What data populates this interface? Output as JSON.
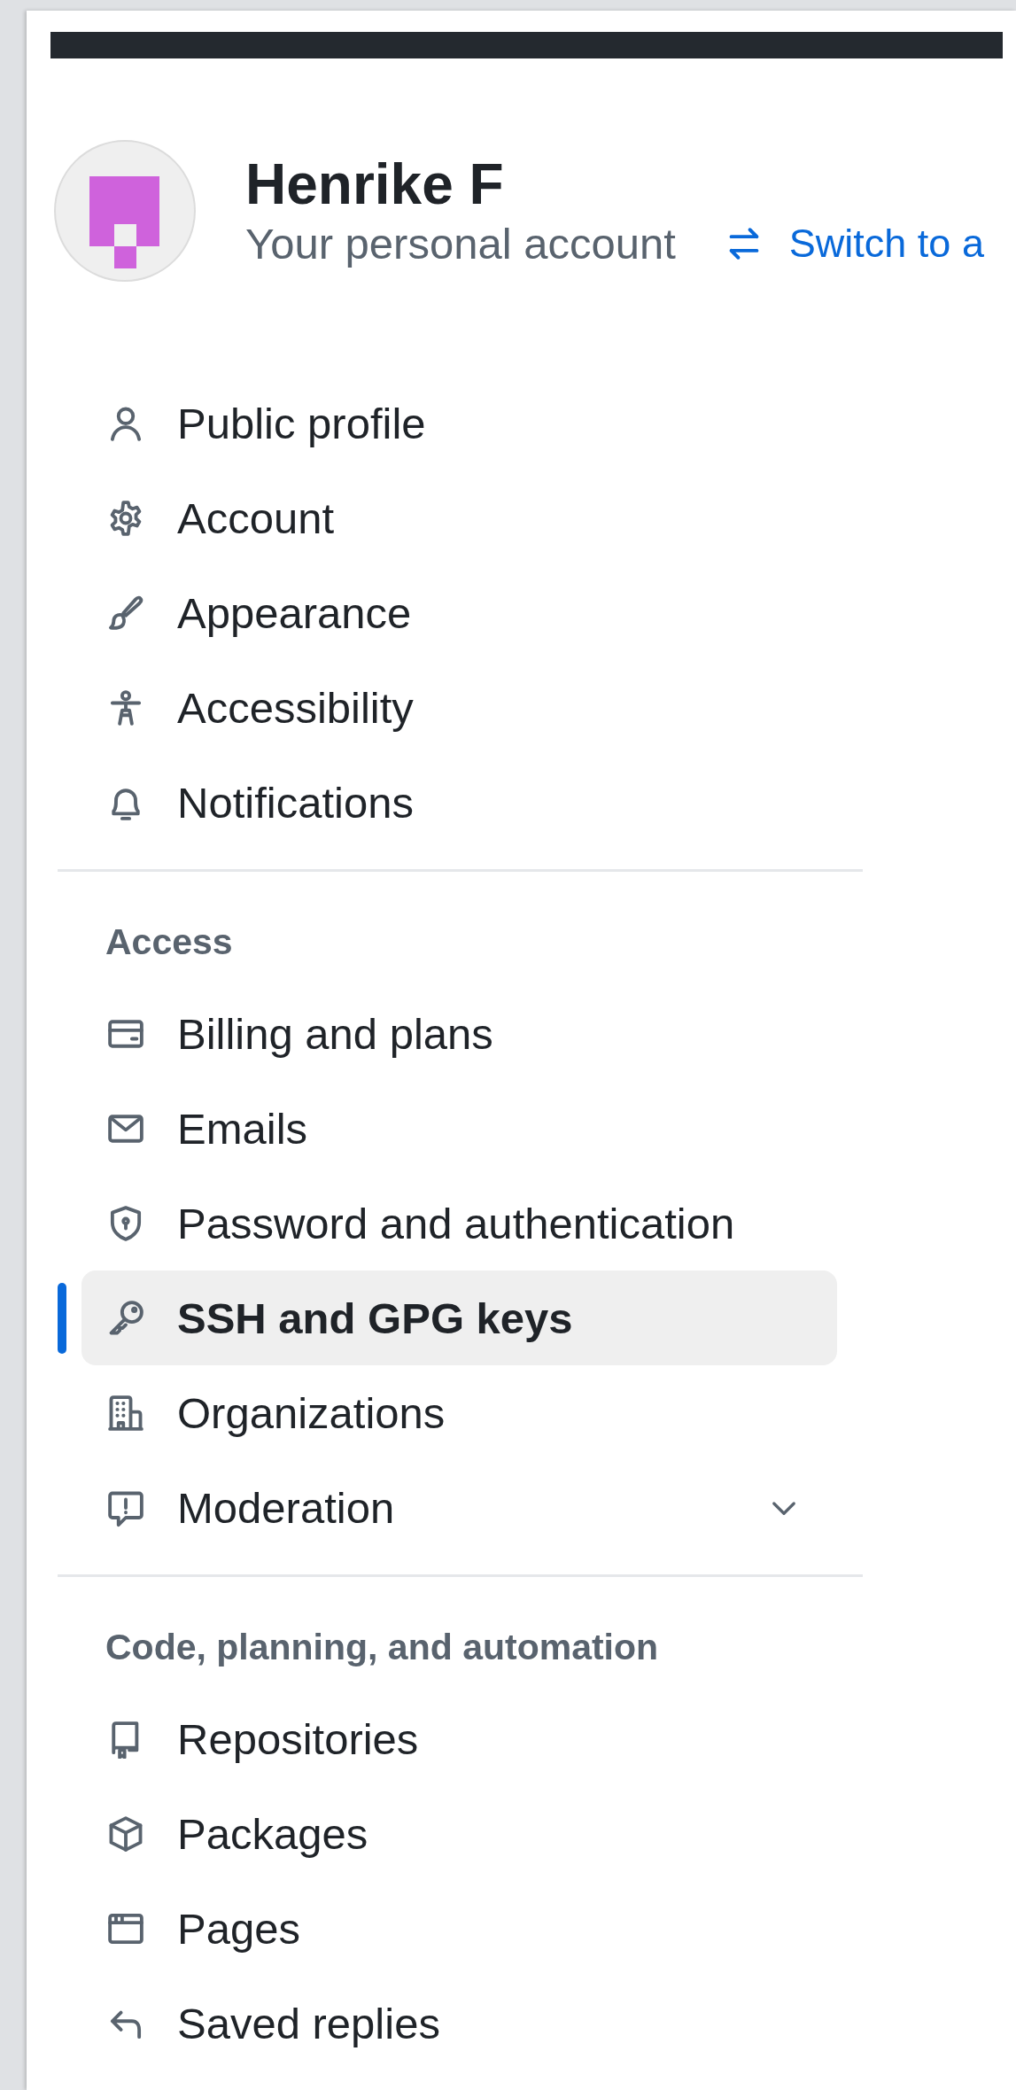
{
  "profile": {
    "name": "Henrike F",
    "subtitle": "Your personal account",
    "switch_link": "Switch to a"
  },
  "sections": [
    {
      "items": [
        {
          "label": "Public profile",
          "kind": "link",
          "selected": false
        },
        {
          "label": "Account",
          "kind": "link",
          "selected": false
        },
        {
          "label": "Appearance",
          "kind": "link",
          "selected": false
        },
        {
          "label": "Accessibility",
          "kind": "link",
          "selected": false
        },
        {
          "label": "Notifications",
          "kind": "link",
          "selected": false
        }
      ]
    },
    {
      "heading": "Access",
      "items": [
        {
          "label": "Billing and plans",
          "kind": "link",
          "selected": false
        },
        {
          "label": "Emails",
          "kind": "link",
          "selected": false
        },
        {
          "label": "Password and authentication",
          "kind": "link",
          "selected": false
        },
        {
          "label": "SSH and GPG keys",
          "kind": "link",
          "selected": true
        },
        {
          "label": "Organizations",
          "kind": "link",
          "selected": false
        },
        {
          "label": "Moderation",
          "kind": "group",
          "selected": false
        }
      ]
    },
    {
      "heading": "Code, planning, and automation",
      "items": [
        {
          "label": "Repositories",
          "kind": "link",
          "selected": false
        },
        {
          "label": "Packages",
          "kind": "link",
          "selected": false
        },
        {
          "label": "Pages",
          "kind": "link",
          "selected": false
        },
        {
          "label": "Saved replies",
          "kind": "link",
          "selected": false
        }
      ]
    }
  ]
}
